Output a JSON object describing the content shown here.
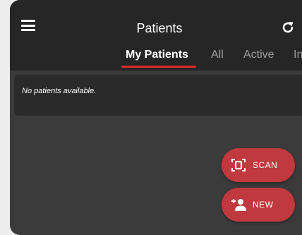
{
  "header": {
    "title": "Patients",
    "menu_icon": "hamburger-menu-icon",
    "refresh_icon": "refresh-icon"
  },
  "tabs": [
    {
      "label": "My Patients",
      "active": true
    },
    {
      "label": "All",
      "active": false
    },
    {
      "label": "Active",
      "active": false
    },
    {
      "label": "In",
      "active": false
    }
  ],
  "patients": {
    "empty_message": "No patients available."
  },
  "actions": {
    "scan": {
      "label": "SCAN",
      "icon": "scan-icon"
    },
    "new": {
      "label": "NEW",
      "icon": "add-person-icon"
    }
  },
  "colors": {
    "accent": "#e02a2a",
    "fab": "#c0393e",
    "header_bg": "#262626",
    "body_bg": "#3b3b3b"
  }
}
